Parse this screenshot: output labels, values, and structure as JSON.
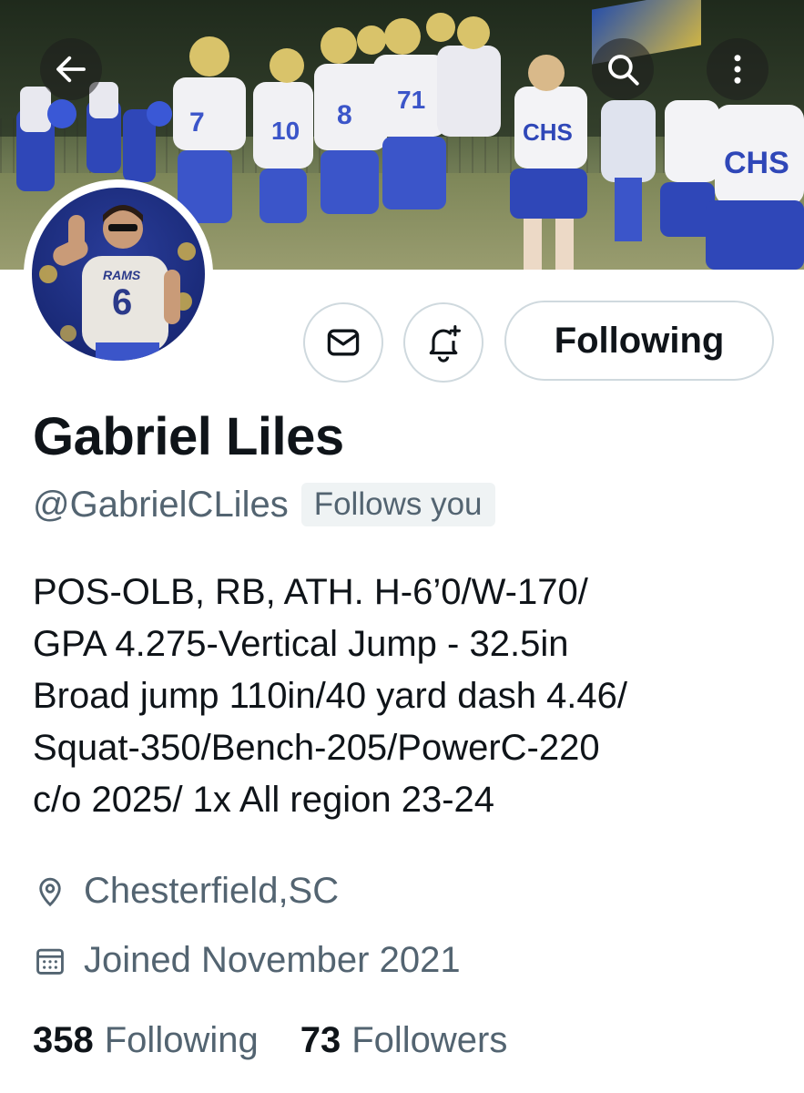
{
  "header": {
    "back_icon": "arrow-left-icon",
    "search_icon": "search-icon",
    "more_icon": "more-vertical-icon"
  },
  "banner": {
    "jersey_numbers": [
      "7",
      "10",
      "8",
      "71"
    ],
    "cheer_text": "CHS"
  },
  "avatar": {
    "jersey_text": "RAMS",
    "jersey_number": "6"
  },
  "actions": {
    "message_icon": "envelope-icon",
    "notify_icon": "bell-plus-icon",
    "follow_label": "Following"
  },
  "profile": {
    "name": "Gabriel Liles",
    "handle": "@GabrielCLiles",
    "follows_you": "Follows you",
    "bio_lines": [
      "POS-OLB, RB, ATH. H-6’0/W-170/",
      "GPA 4.275-Vertical Jump - 32.5in",
      "Broad jump 110in/40 yard dash 4.46/",
      "Squat-350/Bench-205/PowerC-220",
      "c/o 2025/ 1x All region 23-24"
    ],
    "location": "Chesterfield,SC",
    "joined": "Joined November 2021"
  },
  "stats": {
    "following_count": "358",
    "following_label": "Following",
    "followers_count": "73",
    "followers_label": "Followers"
  },
  "colors": {
    "text_primary": "#0f1419",
    "text_secondary": "#536471",
    "border": "#cfd9de",
    "badge_bg": "#eff3f4"
  }
}
